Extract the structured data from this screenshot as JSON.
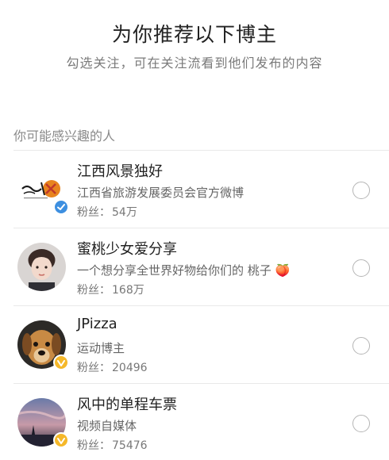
{
  "header": {
    "title": "为你推荐以下博主",
    "subtitle": "勾选关注，可在关注流看到他们发布的内容"
  },
  "section": {
    "title": "你可能感兴趣的人"
  },
  "colors": {
    "verified_blue": "#3d8fe0",
    "verified_gold": "#f5b82a"
  },
  "bloggers": [
    {
      "name": "江西风景独好",
      "description": "江西省旅游发展委员会官方微博",
      "fans_label": "粉丝：",
      "fans_value": "54万",
      "badge": "blue-verified-icon",
      "checked": false
    },
    {
      "name": "蜜桃少女爱分享",
      "description": "一个想分享全世界好物给你们的 桃子 🍑",
      "fans_label": "粉丝：",
      "fans_value": "168万",
      "badge": "",
      "checked": false
    },
    {
      "name": "JPizza",
      "description": "运动博主",
      "fans_label": "粉丝：",
      "fans_value": "20496",
      "badge": "gold-verified-icon",
      "checked": false
    },
    {
      "name": "风中的单程车票",
      "description": "视频自媒体",
      "fans_label": "粉丝：",
      "fans_value": "75476",
      "badge": "gold-verified-icon",
      "checked": false
    }
  ]
}
